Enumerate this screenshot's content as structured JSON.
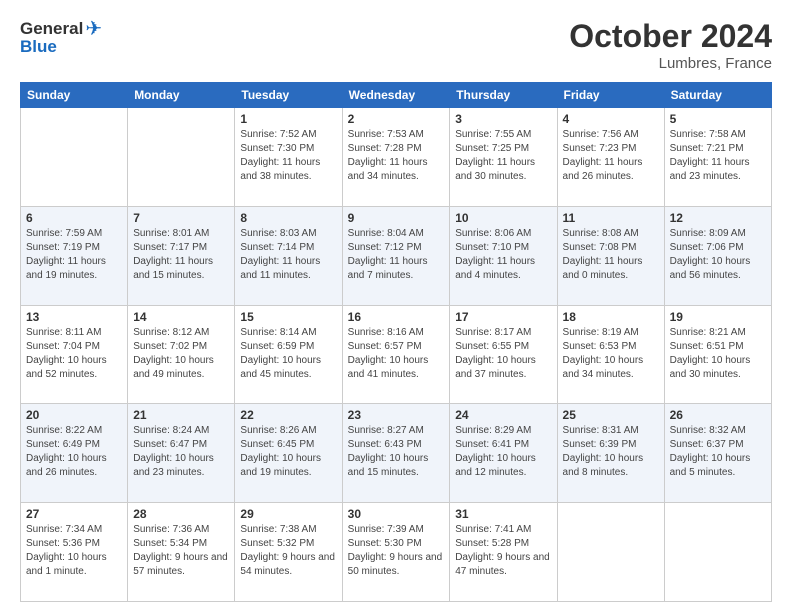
{
  "logo": {
    "general": "General",
    "blue": "Blue"
  },
  "title": "October 2024",
  "location": "Lumbres, France",
  "days_of_week": [
    "Sunday",
    "Monday",
    "Tuesday",
    "Wednesday",
    "Thursday",
    "Friday",
    "Saturday"
  ],
  "weeks": [
    [
      {
        "day": "",
        "info": ""
      },
      {
        "day": "",
        "info": ""
      },
      {
        "day": "1",
        "info": "Sunrise: 7:52 AM\nSunset: 7:30 PM\nDaylight: 11 hours and 38 minutes."
      },
      {
        "day": "2",
        "info": "Sunrise: 7:53 AM\nSunset: 7:28 PM\nDaylight: 11 hours and 34 minutes."
      },
      {
        "day": "3",
        "info": "Sunrise: 7:55 AM\nSunset: 7:25 PM\nDaylight: 11 hours and 30 minutes."
      },
      {
        "day": "4",
        "info": "Sunrise: 7:56 AM\nSunset: 7:23 PM\nDaylight: 11 hours and 26 minutes."
      },
      {
        "day": "5",
        "info": "Sunrise: 7:58 AM\nSunset: 7:21 PM\nDaylight: 11 hours and 23 minutes."
      }
    ],
    [
      {
        "day": "6",
        "info": "Sunrise: 7:59 AM\nSunset: 7:19 PM\nDaylight: 11 hours and 19 minutes."
      },
      {
        "day": "7",
        "info": "Sunrise: 8:01 AM\nSunset: 7:17 PM\nDaylight: 11 hours and 15 minutes."
      },
      {
        "day": "8",
        "info": "Sunrise: 8:03 AM\nSunset: 7:14 PM\nDaylight: 11 hours and 11 minutes."
      },
      {
        "day": "9",
        "info": "Sunrise: 8:04 AM\nSunset: 7:12 PM\nDaylight: 11 hours and 7 minutes."
      },
      {
        "day": "10",
        "info": "Sunrise: 8:06 AM\nSunset: 7:10 PM\nDaylight: 11 hours and 4 minutes."
      },
      {
        "day": "11",
        "info": "Sunrise: 8:08 AM\nSunset: 7:08 PM\nDaylight: 11 hours and 0 minutes."
      },
      {
        "day": "12",
        "info": "Sunrise: 8:09 AM\nSunset: 7:06 PM\nDaylight: 10 hours and 56 minutes."
      }
    ],
    [
      {
        "day": "13",
        "info": "Sunrise: 8:11 AM\nSunset: 7:04 PM\nDaylight: 10 hours and 52 minutes."
      },
      {
        "day": "14",
        "info": "Sunrise: 8:12 AM\nSunset: 7:02 PM\nDaylight: 10 hours and 49 minutes."
      },
      {
        "day": "15",
        "info": "Sunrise: 8:14 AM\nSunset: 6:59 PM\nDaylight: 10 hours and 45 minutes."
      },
      {
        "day": "16",
        "info": "Sunrise: 8:16 AM\nSunset: 6:57 PM\nDaylight: 10 hours and 41 minutes."
      },
      {
        "day": "17",
        "info": "Sunrise: 8:17 AM\nSunset: 6:55 PM\nDaylight: 10 hours and 37 minutes."
      },
      {
        "day": "18",
        "info": "Sunrise: 8:19 AM\nSunset: 6:53 PM\nDaylight: 10 hours and 34 minutes."
      },
      {
        "day": "19",
        "info": "Sunrise: 8:21 AM\nSunset: 6:51 PM\nDaylight: 10 hours and 30 minutes."
      }
    ],
    [
      {
        "day": "20",
        "info": "Sunrise: 8:22 AM\nSunset: 6:49 PM\nDaylight: 10 hours and 26 minutes."
      },
      {
        "day": "21",
        "info": "Sunrise: 8:24 AM\nSunset: 6:47 PM\nDaylight: 10 hours and 23 minutes."
      },
      {
        "day": "22",
        "info": "Sunrise: 8:26 AM\nSunset: 6:45 PM\nDaylight: 10 hours and 19 minutes."
      },
      {
        "day": "23",
        "info": "Sunrise: 8:27 AM\nSunset: 6:43 PM\nDaylight: 10 hours and 15 minutes."
      },
      {
        "day": "24",
        "info": "Sunrise: 8:29 AM\nSunset: 6:41 PM\nDaylight: 10 hours and 12 minutes."
      },
      {
        "day": "25",
        "info": "Sunrise: 8:31 AM\nSunset: 6:39 PM\nDaylight: 10 hours and 8 minutes."
      },
      {
        "day": "26",
        "info": "Sunrise: 8:32 AM\nSunset: 6:37 PM\nDaylight: 10 hours and 5 minutes."
      }
    ],
    [
      {
        "day": "27",
        "info": "Sunrise: 7:34 AM\nSunset: 5:36 PM\nDaylight: 10 hours and 1 minute."
      },
      {
        "day": "28",
        "info": "Sunrise: 7:36 AM\nSunset: 5:34 PM\nDaylight: 9 hours and 57 minutes."
      },
      {
        "day": "29",
        "info": "Sunrise: 7:38 AM\nSunset: 5:32 PM\nDaylight: 9 hours and 54 minutes."
      },
      {
        "day": "30",
        "info": "Sunrise: 7:39 AM\nSunset: 5:30 PM\nDaylight: 9 hours and 50 minutes."
      },
      {
        "day": "31",
        "info": "Sunrise: 7:41 AM\nSunset: 5:28 PM\nDaylight: 9 hours and 47 minutes."
      },
      {
        "day": "",
        "info": ""
      },
      {
        "day": "",
        "info": ""
      }
    ]
  ]
}
